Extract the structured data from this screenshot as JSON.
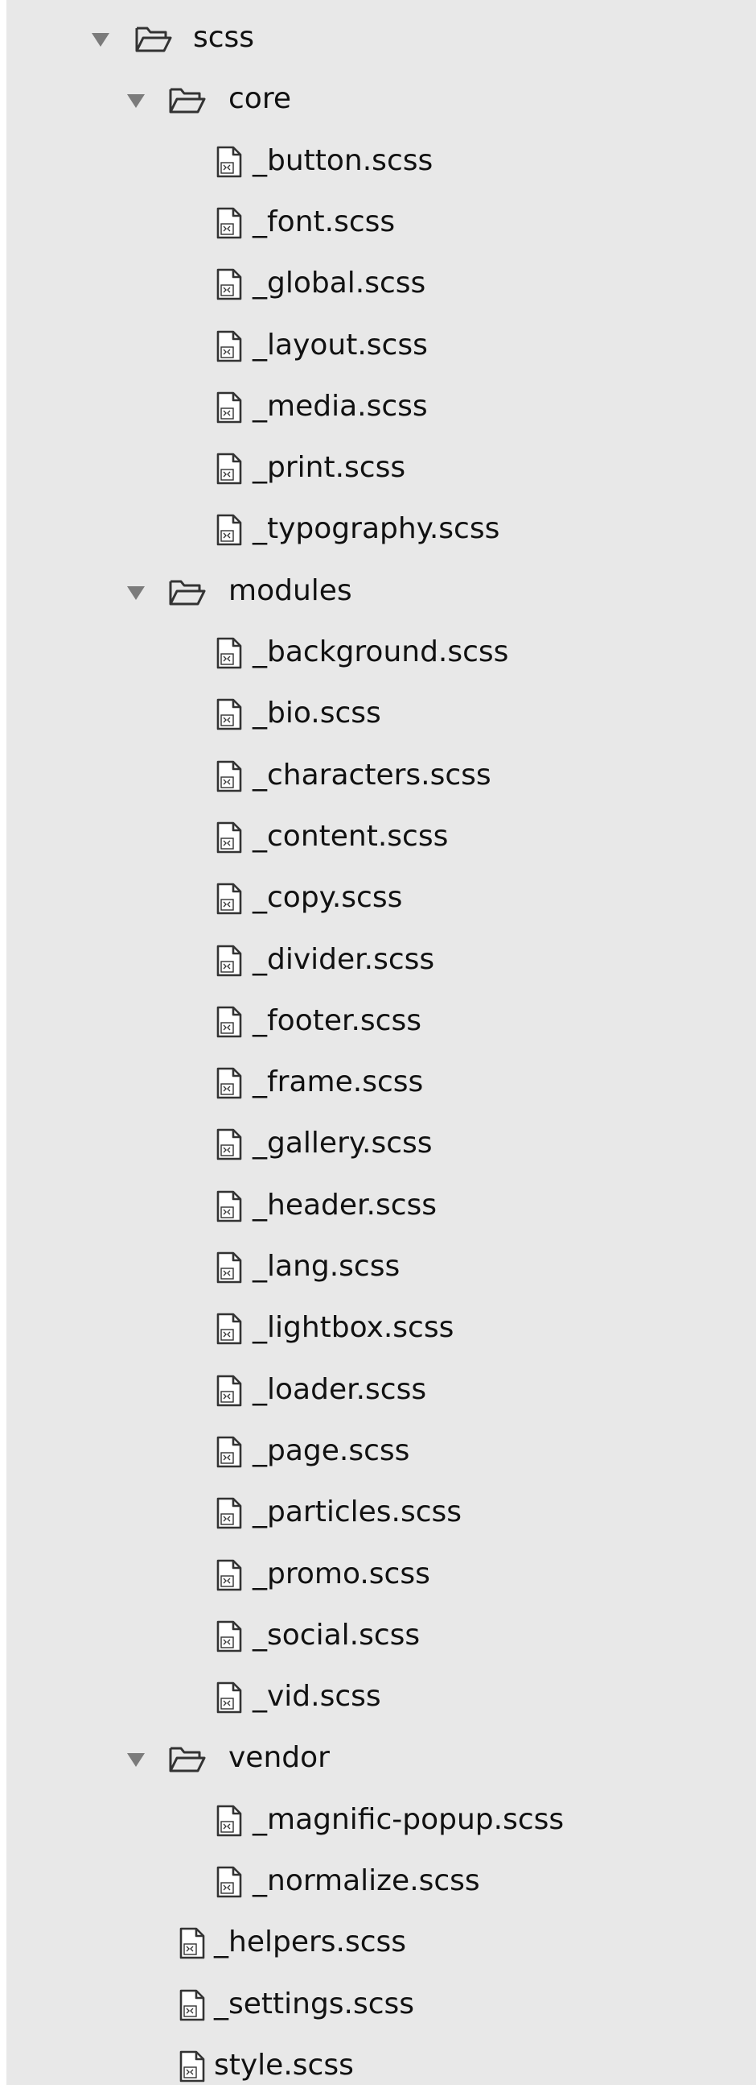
{
  "colors": {
    "panel_background": "#e8e8e8",
    "page_background": "#ffffff",
    "text": "#111111",
    "disclosure_triangle": "#7b7b7b",
    "icon_stroke": "#333333"
  },
  "tree": [
    {
      "label": "scss",
      "type": "folder",
      "expanded": true,
      "depth": 0
    },
    {
      "label": "core",
      "type": "folder",
      "expanded": true,
      "depth": 1
    },
    {
      "label": "_button.scss",
      "type": "file",
      "depth": 2
    },
    {
      "label": "_font.scss",
      "type": "file",
      "depth": 2
    },
    {
      "label": "_global.scss",
      "type": "file",
      "depth": 2
    },
    {
      "label": "_layout.scss",
      "type": "file",
      "depth": 2
    },
    {
      "label": "_media.scss",
      "type": "file",
      "depth": 2
    },
    {
      "label": "_print.scss",
      "type": "file",
      "depth": 2
    },
    {
      "label": "_typography.scss",
      "type": "file",
      "depth": 2
    },
    {
      "label": "modules",
      "type": "folder",
      "expanded": true,
      "depth": 1
    },
    {
      "label": "_background.scss",
      "type": "file",
      "depth": 2
    },
    {
      "label": "_bio.scss",
      "type": "file",
      "depth": 2
    },
    {
      "label": "_characters.scss",
      "type": "file",
      "depth": 2
    },
    {
      "label": "_content.scss",
      "type": "file",
      "depth": 2
    },
    {
      "label": "_copy.scss",
      "type": "file",
      "depth": 2
    },
    {
      "label": "_divider.scss",
      "type": "file",
      "depth": 2
    },
    {
      "label": "_footer.scss",
      "type": "file",
      "depth": 2
    },
    {
      "label": "_frame.scss",
      "type": "file",
      "depth": 2
    },
    {
      "label": "_gallery.scss",
      "type": "file",
      "depth": 2
    },
    {
      "label": "_header.scss",
      "type": "file",
      "depth": 2
    },
    {
      "label": "_lang.scss",
      "type": "file",
      "depth": 2
    },
    {
      "label": "_lightbox.scss",
      "type": "file",
      "depth": 2
    },
    {
      "label": "_loader.scss",
      "type": "file",
      "depth": 2
    },
    {
      "label": "_page.scss",
      "type": "file",
      "depth": 2
    },
    {
      "label": "_particles.scss",
      "type": "file",
      "depth": 2
    },
    {
      "label": "_promo.scss",
      "type": "file",
      "depth": 2
    },
    {
      "label": "_social.scss",
      "type": "file",
      "depth": 2
    },
    {
      "label": "_vid.scss",
      "type": "file",
      "depth": 2
    },
    {
      "label": "vendor",
      "type": "folder",
      "expanded": true,
      "depth": 1
    },
    {
      "label": "_magnific-popup.scss",
      "type": "file",
      "depth": 2
    },
    {
      "label": "_normalize.scss",
      "type": "file",
      "depth": 2
    },
    {
      "label": "_helpers.scss",
      "type": "file",
      "depth": 1
    },
    {
      "label": "_settings.scss",
      "type": "file",
      "depth": 1
    },
    {
      "label": "style.scss",
      "type": "file",
      "depth": 1
    }
  ]
}
